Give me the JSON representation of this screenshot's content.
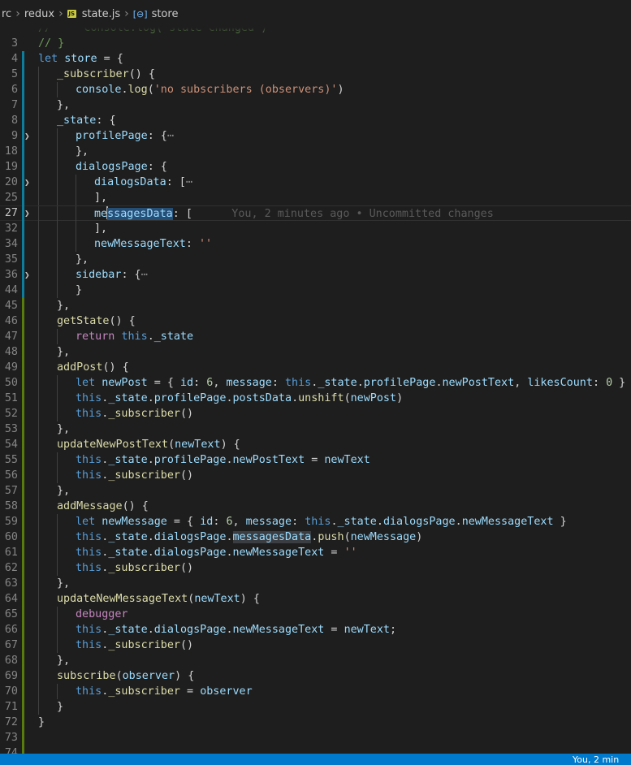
{
  "breadcrumb": {
    "items": [
      "rc",
      "redux",
      "state.js",
      "store"
    ],
    "separator": "›"
  },
  "editor": {
    "current_line": 27,
    "blame_text": "You, 2 minutes ago • Uncommitted changes",
    "lines": [
      {
        "n": "",
        "indent": 0,
        "tokens": [
          [
            "cmt",
            "//     console.log('state changed')"
          ]
        ]
      },
      {
        "n": "3",
        "indent": 0,
        "tokens": [
          [
            "cmt",
            "// }"
          ]
        ]
      },
      {
        "n": "4",
        "indent": 0,
        "tokens": [
          [
            "kw",
            "let"
          ],
          [
            "pun",
            " "
          ],
          [
            "var",
            "store"
          ],
          [
            "pun",
            " = {"
          ]
        ]
      },
      {
        "n": "5",
        "indent": 1,
        "tokens": [
          [
            "fn",
            "_subscriber"
          ],
          [
            "pun",
            "() {"
          ]
        ]
      },
      {
        "n": "6",
        "indent": 2,
        "tokens": [
          [
            "var",
            "console"
          ],
          [
            "pun",
            "."
          ],
          [
            "fn",
            "log"
          ],
          [
            "pun",
            "("
          ],
          [
            "str",
            "'no subscribers (observers)'"
          ],
          [
            "pun",
            ")"
          ]
        ]
      },
      {
        "n": "7",
        "indent": 1,
        "tokens": [
          [
            "pun",
            "},"
          ]
        ]
      },
      {
        "n": "8",
        "indent": 1,
        "tokens": [
          [
            "var",
            "_state"
          ],
          [
            "pun",
            ": {"
          ]
        ]
      },
      {
        "n": "9",
        "indent": 2,
        "fold": true,
        "tokens": [
          [
            "var",
            "profilePage"
          ],
          [
            "pun",
            ": {"
          ],
          [
            "fold-dots",
            "⋯"
          ]
        ]
      },
      {
        "n": "18",
        "indent": 2,
        "tokens": [
          [
            "pun",
            "},"
          ]
        ]
      },
      {
        "n": "19",
        "indent": 2,
        "tokens": [
          [
            "var",
            "dialogsPage"
          ],
          [
            "pun",
            ": {"
          ]
        ]
      },
      {
        "n": "20",
        "indent": 3,
        "fold": true,
        "tokens": [
          [
            "var",
            "dialogsData"
          ],
          [
            "pun",
            ": ["
          ],
          [
            "fold-dots",
            "⋯"
          ]
        ]
      },
      {
        "n": "25",
        "indent": 3,
        "tokens": [
          [
            "pun",
            "],"
          ]
        ]
      },
      {
        "n": "27",
        "indent": 3,
        "fold": true,
        "current": true,
        "tokens": [
          [
            "var",
            "me"
          ],
          [
            "cursor",
            ""
          ],
          [
            "var hl",
            "ssagesData"
          ],
          [
            "pun",
            ": ["
          ]
        ]
      },
      {
        "n": "32",
        "indent": 3,
        "tokens": [
          [
            "pun",
            "],"
          ]
        ]
      },
      {
        "n": "34",
        "indent": 3,
        "tokens": [
          [
            "var",
            "newMessageText"
          ],
          [
            "pun",
            ": "
          ],
          [
            "str",
            "''"
          ]
        ]
      },
      {
        "n": "35",
        "indent": 2,
        "tokens": [
          [
            "pun",
            "},"
          ]
        ]
      },
      {
        "n": "36",
        "indent": 2,
        "fold": true,
        "tokens": [
          [
            "var",
            "sidebar"
          ],
          [
            "pun",
            ": {"
          ],
          [
            "fold-dots",
            "⋯"
          ]
        ]
      },
      {
        "n": "44",
        "indent": 2,
        "tokens": [
          [
            "pun",
            "}"
          ]
        ]
      },
      {
        "n": "45",
        "indent": 1,
        "tokens": [
          [
            "pun",
            "},"
          ]
        ]
      },
      {
        "n": "46",
        "indent": 1,
        "tokens": [
          [
            "fn",
            "getState"
          ],
          [
            "pun",
            "() {"
          ]
        ]
      },
      {
        "n": "47",
        "indent": 2,
        "tokens": [
          [
            "ctl",
            "return"
          ],
          [
            "pun",
            " "
          ],
          [
            "kw",
            "this"
          ],
          [
            "pun",
            "."
          ],
          [
            "var",
            "_state"
          ]
        ]
      },
      {
        "n": "48",
        "indent": 1,
        "tokens": [
          [
            "pun",
            "},"
          ]
        ]
      },
      {
        "n": "49",
        "indent": 1,
        "tokens": [
          [
            "fn",
            "addPost"
          ],
          [
            "pun",
            "() {"
          ]
        ]
      },
      {
        "n": "50",
        "indent": 2,
        "tokens": [
          [
            "kw",
            "let"
          ],
          [
            "pun",
            " "
          ],
          [
            "var",
            "newPost"
          ],
          [
            "pun",
            " = { "
          ],
          [
            "var",
            "id"
          ],
          [
            "pun",
            ": "
          ],
          [
            "num",
            "6"
          ],
          [
            "pun",
            ", "
          ],
          [
            "var",
            "message"
          ],
          [
            "pun",
            ": "
          ],
          [
            "kw",
            "this"
          ],
          [
            "pun",
            "."
          ],
          [
            "var",
            "_state"
          ],
          [
            "pun",
            "."
          ],
          [
            "var",
            "profilePage"
          ],
          [
            "pun",
            "."
          ],
          [
            "var",
            "newPostText"
          ],
          [
            "pun",
            ", "
          ],
          [
            "var",
            "likesCount"
          ],
          [
            "pun",
            ": "
          ],
          [
            "num",
            "0"
          ],
          [
            "pun",
            " }"
          ]
        ]
      },
      {
        "n": "51",
        "indent": 2,
        "tokens": [
          [
            "kw",
            "this"
          ],
          [
            "pun",
            "."
          ],
          [
            "var",
            "_state"
          ],
          [
            "pun",
            "."
          ],
          [
            "var",
            "profilePage"
          ],
          [
            "pun",
            "."
          ],
          [
            "var",
            "postsData"
          ],
          [
            "pun",
            "."
          ],
          [
            "fn",
            "unshift"
          ],
          [
            "pun",
            "("
          ],
          [
            "var",
            "newPost"
          ],
          [
            "pun",
            ")"
          ]
        ]
      },
      {
        "n": "52",
        "indent": 2,
        "tokens": [
          [
            "kw",
            "this"
          ],
          [
            "pun",
            "."
          ],
          [
            "fn",
            "_subscriber"
          ],
          [
            "pun",
            "()"
          ]
        ]
      },
      {
        "n": "53",
        "indent": 1,
        "tokens": [
          [
            "pun",
            "},"
          ]
        ]
      },
      {
        "n": "54",
        "indent": 1,
        "tokens": [
          [
            "fn",
            "updateNewPostText"
          ],
          [
            "pun",
            "("
          ],
          [
            "var",
            "newText"
          ],
          [
            "pun",
            ") {"
          ]
        ]
      },
      {
        "n": "55",
        "indent": 2,
        "tokens": [
          [
            "kw",
            "this"
          ],
          [
            "pun",
            "."
          ],
          [
            "var",
            "_state"
          ],
          [
            "pun",
            "."
          ],
          [
            "var",
            "profilePage"
          ],
          [
            "pun",
            "."
          ],
          [
            "var",
            "newPostText"
          ],
          [
            "pun",
            " = "
          ],
          [
            "var",
            "newText"
          ]
        ]
      },
      {
        "n": "56",
        "indent": 2,
        "tokens": [
          [
            "kw",
            "this"
          ],
          [
            "pun",
            "."
          ],
          [
            "fn",
            "_subscriber"
          ],
          [
            "pun",
            "()"
          ]
        ]
      },
      {
        "n": "57",
        "indent": 1,
        "tokens": [
          [
            "pun",
            "},"
          ]
        ]
      },
      {
        "n": "58",
        "indent": 1,
        "tokens": [
          [
            "fn",
            "addMessage"
          ],
          [
            "pun",
            "() {"
          ]
        ]
      },
      {
        "n": "59",
        "indent": 2,
        "tokens": [
          [
            "kw",
            "let"
          ],
          [
            "pun",
            " "
          ],
          [
            "var",
            "newMessage"
          ],
          [
            "pun",
            " = { "
          ],
          [
            "var",
            "id"
          ],
          [
            "pun",
            ": "
          ],
          [
            "num",
            "6"
          ],
          [
            "pun",
            ", "
          ],
          [
            "var",
            "message"
          ],
          [
            "pun",
            ": "
          ],
          [
            "kw",
            "this"
          ],
          [
            "pun",
            "."
          ],
          [
            "var",
            "_state"
          ],
          [
            "pun",
            "."
          ],
          [
            "var",
            "dialogsPage"
          ],
          [
            "pun",
            "."
          ],
          [
            "var",
            "newMessageText"
          ],
          [
            "pun",
            " }"
          ]
        ]
      },
      {
        "n": "60",
        "indent": 2,
        "tokens": [
          [
            "kw",
            "this"
          ],
          [
            "pun",
            "."
          ],
          [
            "var",
            "_state"
          ],
          [
            "pun",
            "."
          ],
          [
            "var",
            "dialogsPage"
          ],
          [
            "pun",
            "."
          ],
          [
            "var hl2",
            "messagesData"
          ],
          [
            "pun",
            "."
          ],
          [
            "fn",
            "push"
          ],
          [
            "pun",
            "("
          ],
          [
            "var",
            "newMessage"
          ],
          [
            "pun",
            ")"
          ]
        ]
      },
      {
        "n": "61",
        "indent": 2,
        "tokens": [
          [
            "kw",
            "this"
          ],
          [
            "pun",
            "."
          ],
          [
            "var",
            "_state"
          ],
          [
            "pun",
            "."
          ],
          [
            "var",
            "dialogsPage"
          ],
          [
            "pun",
            "."
          ],
          [
            "var",
            "newMessageText"
          ],
          [
            "pun",
            " = "
          ],
          [
            "str",
            "''"
          ]
        ]
      },
      {
        "n": "62",
        "indent": 2,
        "tokens": [
          [
            "kw",
            "this"
          ],
          [
            "pun",
            "."
          ],
          [
            "fn",
            "_subscriber"
          ],
          [
            "pun",
            "()"
          ]
        ]
      },
      {
        "n": "63",
        "indent": 1,
        "tokens": [
          [
            "pun",
            "},"
          ]
        ]
      },
      {
        "n": "64",
        "indent": 1,
        "tokens": [
          [
            "fn",
            "updateNewMessageText"
          ],
          [
            "pun",
            "("
          ],
          [
            "var",
            "newText"
          ],
          [
            "pun",
            ") {"
          ]
        ]
      },
      {
        "n": "65",
        "indent": 2,
        "tokens": [
          [
            "ctl",
            "debugger"
          ]
        ]
      },
      {
        "n": "66",
        "indent": 2,
        "tokens": [
          [
            "kw",
            "this"
          ],
          [
            "pun",
            "."
          ],
          [
            "var",
            "_state"
          ],
          [
            "pun",
            "."
          ],
          [
            "var",
            "dialogsPage"
          ],
          [
            "pun",
            "."
          ],
          [
            "var",
            "newMessageText"
          ],
          [
            "pun",
            " = "
          ],
          [
            "var",
            "newText"
          ],
          [
            "pun",
            ";"
          ]
        ]
      },
      {
        "n": "67",
        "indent": 2,
        "tokens": [
          [
            "kw",
            "this"
          ],
          [
            "pun",
            "."
          ],
          [
            "fn",
            "_subscriber"
          ],
          [
            "pun",
            "()"
          ]
        ]
      },
      {
        "n": "68",
        "indent": 1,
        "tokens": [
          [
            "pun",
            "},"
          ]
        ]
      },
      {
        "n": "69",
        "indent": 1,
        "tokens": [
          [
            "fn",
            "subscribe"
          ],
          [
            "pun",
            "("
          ],
          [
            "var",
            "observer"
          ],
          [
            "pun",
            ") {"
          ]
        ]
      },
      {
        "n": "70",
        "indent": 2,
        "tokens": [
          [
            "kw",
            "this"
          ],
          [
            "pun",
            "."
          ],
          [
            "fn",
            "_subscriber"
          ],
          [
            "pun",
            " = "
          ],
          [
            "var",
            "observer"
          ]
        ]
      },
      {
        "n": "71",
        "indent": 1,
        "tokens": [
          [
            "pun",
            "}"
          ]
        ]
      },
      {
        "n": "72",
        "indent": 0,
        "tokens": [
          [
            "pun",
            "}"
          ]
        ]
      },
      {
        "n": "73",
        "indent": 0,
        "tokens": []
      },
      {
        "n": "74",
        "indent": 0,
        "tokens": []
      }
    ]
  },
  "statusbar": {
    "blame": "You, 2 min"
  },
  "colors": {
    "editor_background": "#1e1e1e",
    "statusbar_background": "#007acc",
    "git_added": "#587c0c",
    "git_modified": "#0c7d9d",
    "keyword": "#569cd6",
    "variable": "#9cdcfe",
    "function": "#dcdcaa",
    "string": "#ce9178",
    "number": "#b5cea8",
    "comment": "#6a9955"
  }
}
